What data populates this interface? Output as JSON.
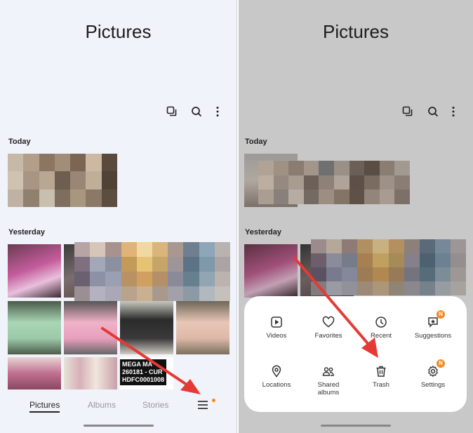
{
  "left": {
    "title": "Pictures",
    "section_today": "Today",
    "section_yesterday": "Yesterday",
    "mega_lines": [
      "MEGA MA",
      "260181 - CUR",
      "HDFC0001008"
    ],
    "nav": {
      "tab1": "Pictures",
      "tab2": "Albums",
      "tab3": "Stories"
    }
  },
  "right": {
    "title": "Pictures",
    "section_today": "Today",
    "section_yesterday": "Yesterday",
    "menu": {
      "videos": "Videos",
      "favorites": "Favorites",
      "recent": "Recent",
      "suggestions": "Suggestions",
      "locations": "Locations",
      "shared_albums": "Shared\nalbums",
      "trash": "Trash",
      "settings": "Settings",
      "badge": "N"
    }
  },
  "colors": {
    "accent_orange": "#f08a24",
    "arrow_red": "#e53935"
  }
}
